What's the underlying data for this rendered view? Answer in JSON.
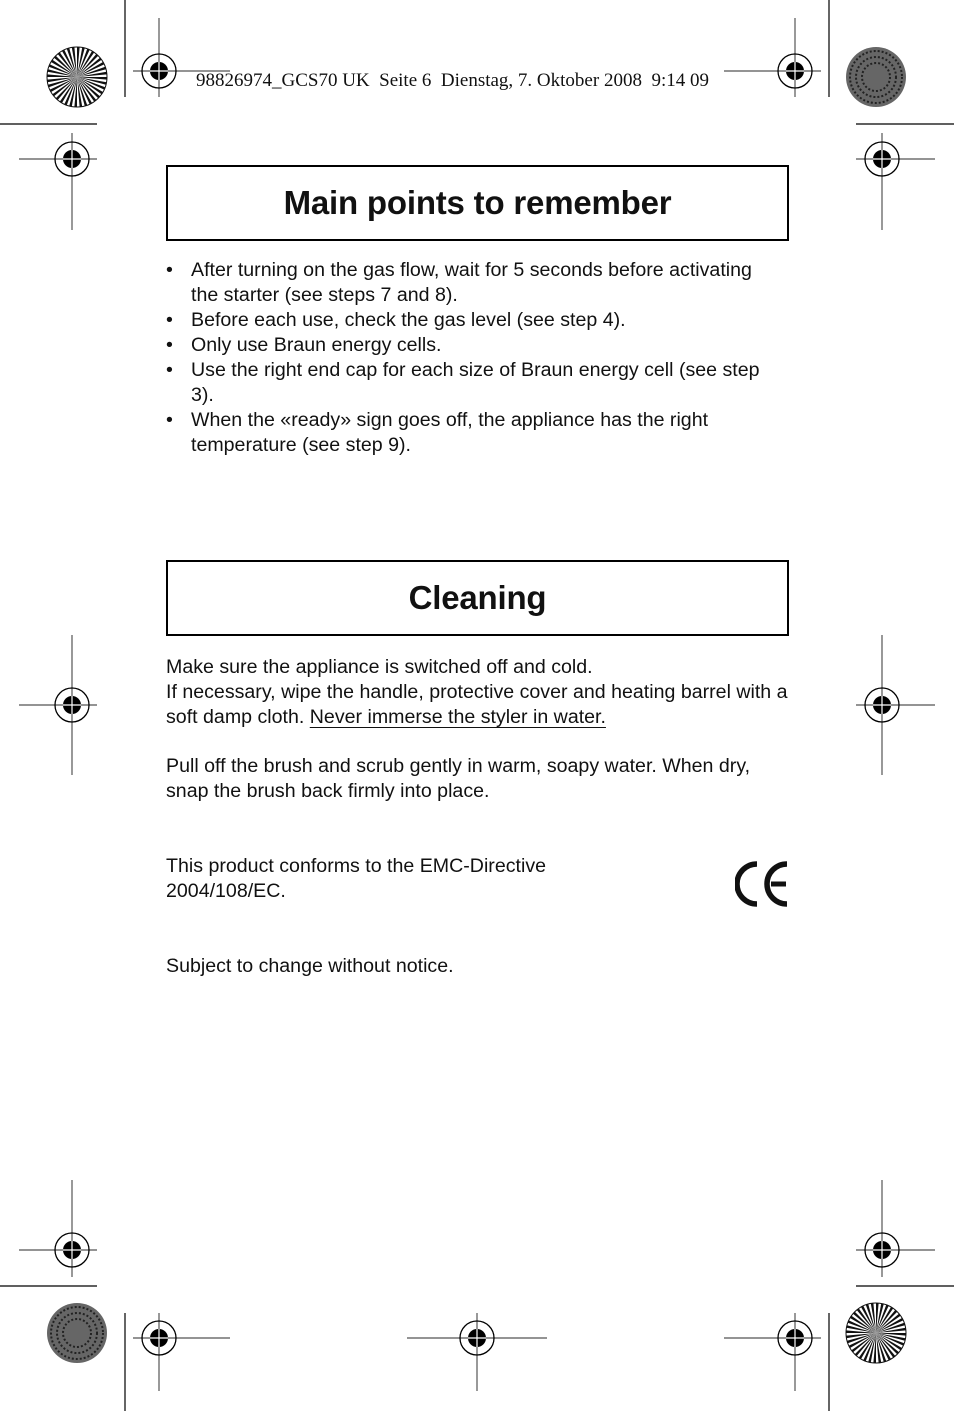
{
  "header": {
    "slug": "98826974_GCS70 UK  Seite 6  Dienstag, 7. Oktober 2008  9:14 09"
  },
  "section_main_points": {
    "title": "Main points to remember",
    "bullet_glyph": "•",
    "items": [
      "After turning on the gas flow, wait for 5 seconds before activating the starter (see steps 7 and 8).",
      "Before each use, check the gas level (see step 4).",
      "Only use Braun energy cells.",
      "Use the right end cap for each size of Braun energy cell (see step 3).",
      "When the «ready» sign goes off, the appliance has the right temperature (see step 9)."
    ]
  },
  "section_cleaning": {
    "title": "Cleaning",
    "para1_line1": "Make sure the appliance is switched off and cold.",
    "para1_line2": "If necessary, wipe the handle, protective cover and heating barrel with a soft damp cloth. ",
    "para1_warning": "Never immerse the styler in water.",
    "para2": "Pull off the brush and scrub gently in warm, soapy water. When dry, snap the brush back firmly into place."
  },
  "conformity": {
    "text": "This product conforms to the EMC-Directive 2004/108/EC.",
    "mark": "CE"
  },
  "notice": "Subject to change without notice."
}
